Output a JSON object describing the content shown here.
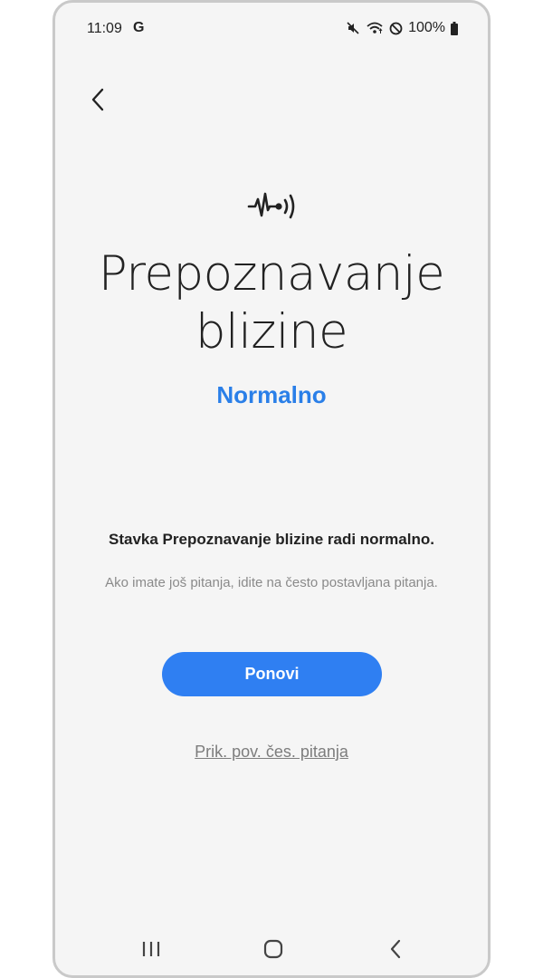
{
  "status_bar": {
    "time": "11:09",
    "g_logo": "G",
    "battery": "100%",
    "icons": [
      "mute-icon",
      "wifi-icon",
      "do-not-disturb-icon",
      "battery-icon"
    ]
  },
  "header": {
    "back_icon": "chevron-left-icon"
  },
  "hero": {
    "icon": "proximity-sensor-icon",
    "title": "Prepoznavanje blizine",
    "status": "Normalno"
  },
  "message": {
    "title": "Stavka Prepoznavanje blizine radi normalno.",
    "subtitle": "Ako imate još pitanja, idite na često postavljana pitanja."
  },
  "actions": {
    "retry_label": "Ponovi",
    "faq_label": "Prik. pov. čes. pitanja"
  },
  "nav_bar": {
    "icons": [
      "recents-icon",
      "home-icon",
      "back-icon"
    ]
  },
  "colors": {
    "accent": "#2f7ff2",
    "status_text": "#2a7fe8",
    "background": "#f5f5f5"
  }
}
